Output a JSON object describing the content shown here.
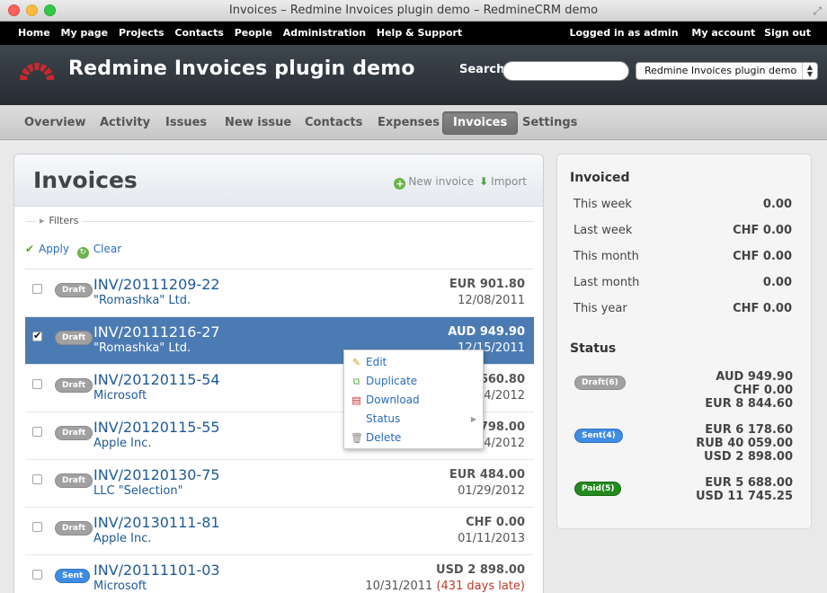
{
  "window": {
    "title": "Invoices – Redmine Invoices plugin demo – RedmineCRM demo"
  },
  "top_menu": {
    "left": [
      "Home",
      "My page",
      "Projects",
      "Contacts",
      "People",
      "Administration",
      "Help & Support"
    ],
    "logged_in": "Logged in as admin",
    "my_account": "My account",
    "sign_out": "Sign out"
  },
  "header": {
    "title": "Redmine Invoices plugin demo",
    "search_label": "Search:",
    "search_value": "",
    "project_select": "Redmine Invoices plugin demo"
  },
  "tabs": [
    "Overview",
    "Activity",
    "Issues",
    "New issue",
    "Contacts",
    "Expenses",
    "Invoices",
    "Settings"
  ],
  "selected_tab": "Invoices",
  "content": {
    "title": "Invoices",
    "new_invoice": "New invoice",
    "import": "Import",
    "filters": "Filters",
    "apply": "Apply",
    "clear": "Clear"
  },
  "invoices": [
    {
      "status": "Draft",
      "number": "INV/20111209-22",
      "company": "\"Romashka\" Ltd.",
      "amount": "EUR 901.80",
      "date": "12/08/2011",
      "late": "",
      "checked": false
    },
    {
      "status": "Draft",
      "number": "INV/20111216-27",
      "company": "\"Romashka\" Ltd.",
      "amount": "AUD 949.90",
      "date": "12/15/2011",
      "late": "",
      "checked": true
    },
    {
      "status": "Draft",
      "number": "INV/20120115-54",
      "company": "Microsoft",
      "amount": "660.80",
      "date": "4/2012",
      "late": "",
      "checked": false
    },
    {
      "status": "Draft",
      "number": "INV/20120115-55",
      "company": "Apple Inc.",
      "amount": "798.00",
      "date": "4/2012",
      "late": "",
      "checked": false
    },
    {
      "status": "Draft",
      "number": "INV/20120130-75",
      "company": "LLC \"Selection\"",
      "amount": "EUR 484.00",
      "date": "01/29/2012",
      "late": "",
      "checked": false
    },
    {
      "status": "Draft",
      "number": "INV/20130111-81",
      "company": "Apple Inc.",
      "amount": "CHF 0.00",
      "date": "01/11/2013",
      "late": "",
      "checked": false
    },
    {
      "status": "Sent",
      "number": "INV/20111101-03",
      "company": "Microsoft",
      "amount": "USD 2 898.00",
      "date": "10/31/2011",
      "late": "(431 days late)",
      "checked": false
    }
  ],
  "context_menu": {
    "items": [
      {
        "label": "Edit",
        "icon": "pencil-icon"
      },
      {
        "label": "Duplicate",
        "icon": "duplicate-icon"
      },
      {
        "label": "Download",
        "icon": "pdf-icon"
      },
      {
        "label": "Status",
        "icon": ""
      },
      {
        "label": "Delete",
        "icon": "trash-icon"
      }
    ]
  },
  "sidebar": {
    "invoiced_title": "Invoiced",
    "invoiced": [
      {
        "label": "This week",
        "value": "0.00"
      },
      {
        "label": "Last week",
        "value": "CHF 0.00"
      },
      {
        "label": "This month",
        "value": "CHF 0.00"
      },
      {
        "label": "Last month",
        "value": "0.00"
      },
      {
        "label": "This year",
        "value": "CHF 0.00"
      }
    ],
    "status_title": "Status",
    "status": [
      {
        "badge": "Draft(6)",
        "color": "#a1a1a1",
        "amounts": [
          "AUD 949.90",
          "CHF 0.00",
          "EUR 8 844.60"
        ]
      },
      {
        "badge": "Sent(4)",
        "color": "#3f8ce3",
        "amounts": [
          "EUR 6 178.60",
          "RUB 40 059.00",
          "USD 2 898.00"
        ]
      },
      {
        "badge": "Paid(5)",
        "color": "#258a1e",
        "amounts": [
          "EUR 5 688.00",
          "USD 11 745.25"
        ]
      }
    ]
  }
}
